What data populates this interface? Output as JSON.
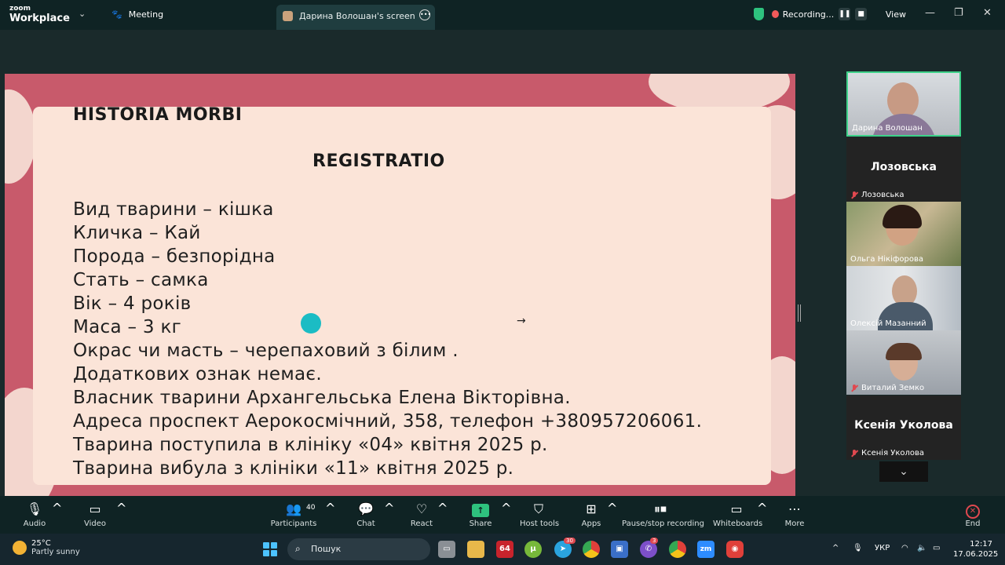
{
  "titlebar": {
    "logo_small": "zoom",
    "logo_big": "Workplace",
    "meeting_label": "Meeting",
    "screen_tab_label": "Дарина Волошан's screen",
    "recording_label": "Recording...",
    "view_label": "View"
  },
  "slide": {
    "title": "HISTORIA MORBI",
    "subtitle": "REGISTRATIO",
    "lines": [
      "Вид тварини – кішка",
      "Кличка – Кай",
      "Порода – безпорідна",
      "Стать – самка",
      "Вік – 4 років",
      "Маса – 3 кг",
      "Окрас чи масть – черепаховий з білим .",
      "Додаткових ознак немає.",
      "Власник тварини Архангельська Елена Вікторівна.",
      "Адреса проспект Аерокосмічний, 358, телефон +380957206061.",
      "Тварина поступила в клініку «04» квітня 2025 р.",
      "Тварина вибула з клініки «11» квітня 2025 р."
    ]
  },
  "participants": [
    {
      "name": "Дарина Волошан",
      "muted": false,
      "video": true
    },
    {
      "name": "Лозовська",
      "big_name": "Лозовська",
      "muted": true,
      "video": false
    },
    {
      "name": "Ольга Нікіфорова",
      "muted": false,
      "video": true
    },
    {
      "name": "Олексій Мазанний",
      "muted": false,
      "video": true
    },
    {
      "name": "Виталий Земко",
      "muted": true,
      "video": true
    },
    {
      "name": "Ксенія Уколова",
      "big_name": "Ксенія Уколова",
      "muted": true,
      "video": false
    }
  ],
  "toolbar": {
    "audio": "Audio",
    "video": "Video",
    "participants": "Participants",
    "participants_count": "40",
    "chat": "Chat",
    "react": "React",
    "share": "Share",
    "host_tools": "Host tools",
    "apps": "Apps",
    "recording": "Pause/stop recording",
    "whiteboards": "Whiteboards",
    "more": "More",
    "end": "End"
  },
  "taskbar": {
    "temperature": "25°C",
    "weather": "Partly sunny",
    "search_placeholder": "Пошук",
    "app_64": "64",
    "badge_telegram": "30",
    "badge_viber": "3",
    "lang": "УКР",
    "time": "12:17",
    "date": "17.06.2025"
  },
  "colors": {
    "accent_green": "#2ec27e",
    "slide_border": "#c85a6b",
    "slide_bg": "#fbe4d8",
    "end_red": "#e0484f"
  }
}
